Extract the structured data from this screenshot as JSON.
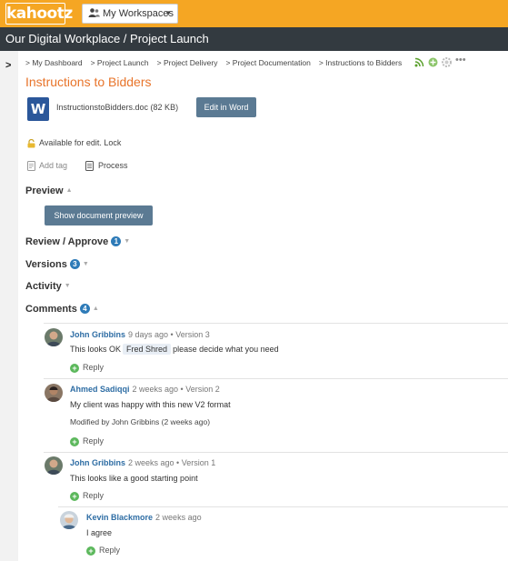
{
  "header": {
    "logo_text": "kahootz",
    "workspace_button": "My Workspaces"
  },
  "title_bar": {
    "text": "Our Digital Workplace / Project Launch"
  },
  "breadcrumb": {
    "items": [
      "> My Dashboard",
      "> Project Launch",
      "> Project Delivery",
      "> Project Documentation",
      "> Instructions to Bidders"
    ]
  },
  "document": {
    "title": "Instructions to Bidders",
    "file_name": "InstructionstoBidders.doc (82 KB)",
    "edit_button": "Edit in Word",
    "status": "Available for edit. Lock",
    "add_tag": "Add tag",
    "process": "Process"
  },
  "sections": {
    "preview": "Preview",
    "preview_button": "Show document preview",
    "review": "Review / Approve",
    "review_count": "1",
    "versions": "Versions",
    "versions_count": "3",
    "activity": "Activity",
    "comments": "Comments",
    "comments_count": "4"
  },
  "comments": [
    {
      "author": "John Gribbins",
      "meta": "9 days ago • Version 3",
      "text_before": "This looks OK",
      "mention": "Fred Shred",
      "text_after": "please decide what you need",
      "reply": "Reply"
    },
    {
      "author": "Ahmed Sadiqqi",
      "meta": "2 weeks ago • Version 2",
      "text": "My client was happy with this new V2 format",
      "modified": "Modified by John Gribbins (2 weeks ago)",
      "reply": "Reply"
    },
    {
      "author": "John Gribbins",
      "meta": "2 weeks ago • Version 1",
      "text": "This looks like a good starting point",
      "reply": "Reply"
    },
    {
      "author": "Kevin Blackmore",
      "meta": "2 weeks ago",
      "text": "I agree",
      "reply": "Reply"
    }
  ],
  "colors": {
    "brand_orange": "#f5a623",
    "title_bar": "#333a40",
    "doc_title": "#e8742a",
    "button": "#5b7a93",
    "badge": "#2e7bb8",
    "author": "#2e6da4",
    "reply_icon": "#5cb85c"
  }
}
